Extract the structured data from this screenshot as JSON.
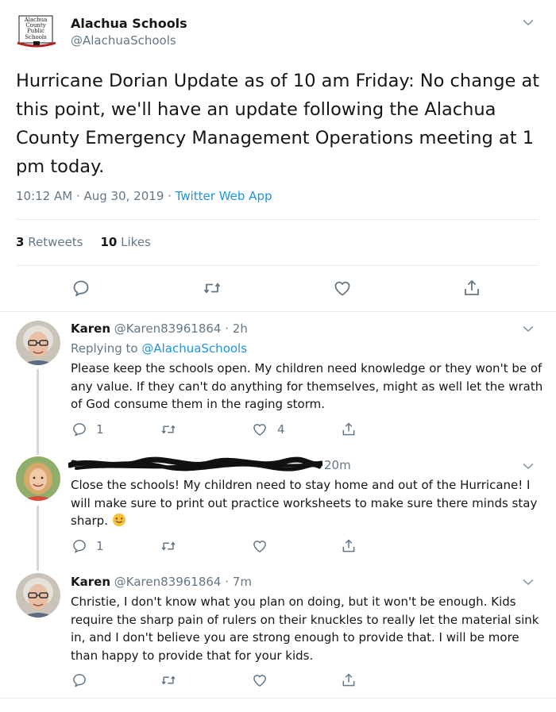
{
  "main_tweet": {
    "author_name": "Alachua Schools",
    "handle": "@AlachuaSchools",
    "logo_text": [
      "Alachua",
      "County",
      "Public",
      "Schools"
    ],
    "text": "Hurricane Dorian Update as of 10 am Friday: No change at this point, we'll have an update following the Alachua County Emergency Management Operations meeting at 1 pm today.",
    "timestamp": "10:12 AM · Aug 30, 2019 · ",
    "source": "Twitter Web App",
    "retweets_count": "3",
    "retweets_label": "Retweets",
    "likes_count": "10",
    "likes_label": "Likes"
  },
  "replies": [
    {
      "name": "Karen",
      "handle_time": "@Karen83961864 · 2h",
      "replying_prefix": "Replying to ",
      "replying_to": "@AlachuaSchools",
      "text": "Please keep the schools open. My children need knowledge or they won't be of any value. If they can't do anything for themselves, might as well let the wrath of God consume them in the raging storm.",
      "reply_count": "1",
      "like_count": "4"
    },
    {
      "time": "20m",
      "text": "Close the schools! My children need to stay home and out of the Hurricane! I will make sure to print out practice worksheets to make sure there minds stay sharp.",
      "emoji": "smiling-face-emoji",
      "reply_count": "1"
    },
    {
      "name": "Karen",
      "handle_time": "@Karen83961864 · 7m",
      "text": "Christie, I don't know what you plan on doing, but it won't be enough. Kids require the sharp pain of rulers on their knuckles to really let the material sink in, and I don't believe you are strong enough to provide that. I will be more than happy to provide that for your kids."
    }
  ],
  "icons": {
    "reply": "reply-icon",
    "retweet": "retweet-icon",
    "like": "heart-icon",
    "share": "share-icon",
    "menu": "chevron-down-icon"
  },
  "colors": {
    "link": "#1b95e0",
    "muted": "#657786",
    "text": "#14171a",
    "divider": "#e6ecf0"
  }
}
